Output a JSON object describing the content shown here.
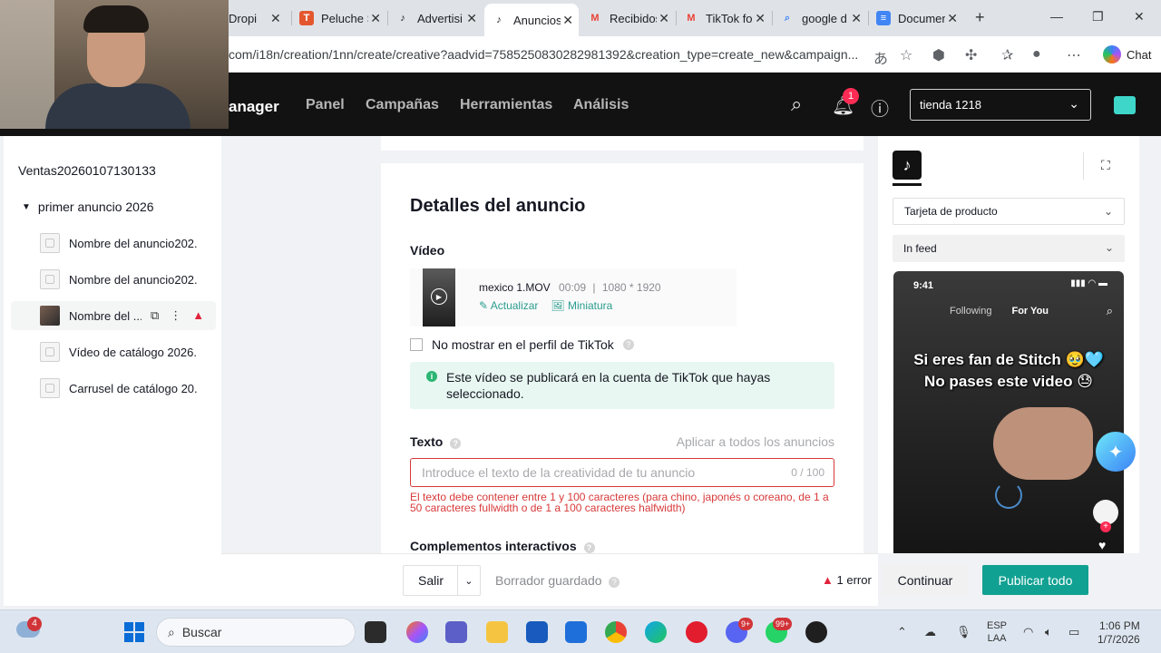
{
  "browser": {
    "tabs": [
      {
        "label": "Dropi",
        "favicon": "dropi",
        "color": "#e0e0e0"
      },
      {
        "label": "Peluche S",
        "favicon": "temu-T",
        "color": "#e4572e"
      },
      {
        "label": "Advertisi",
        "favicon": "tiktok",
        "color": "#121212"
      },
      {
        "label": "Anuncios",
        "favicon": "tiktok",
        "color": "#121212"
      },
      {
        "label": "Recibidos",
        "favicon": "gmail-M",
        "color": "#ea4335"
      },
      {
        "label": "TikTok fo",
        "favicon": "gmail-M",
        "color": "#ea4335"
      },
      {
        "label": "google d",
        "favicon": "search",
        "color": "#4285f4"
      },
      {
        "label": "Documen",
        "favicon": "docs",
        "color": "#4285f4"
      }
    ],
    "active_tab": 3,
    "url": "com/i18n/creation/1nn/create/creative?aadvid=7585250830282981392&creation_type=create_new&campaign...",
    "chat_label": "Chat"
  },
  "header": {
    "brand": "anager",
    "nav": [
      "Panel",
      "Campañas",
      "Herramientas",
      "Análisis"
    ],
    "notification_count": "1",
    "account": "tienda 1218"
  },
  "sidebar": {
    "campaign": "Ventas20260107130133",
    "group": "primer anuncio 2026",
    "items": [
      {
        "label": "Nombre del anuncio202...",
        "selected": false
      },
      {
        "label": "Nombre del anuncio202...",
        "selected": false
      },
      {
        "label": "Nombre del ...",
        "selected": true
      },
      {
        "label": "Vídeo de catálogo 2026...",
        "selected": false
      },
      {
        "label": "Carrusel de catálogo 20...",
        "selected": false
      }
    ]
  },
  "form": {
    "title": "Detalles del anuncio",
    "video_label": "Vídeo",
    "video": {
      "name": "mexico 1.MOV",
      "duration": "00:09",
      "separator": "|",
      "resolution": "1080 * 1920",
      "update_label": "Actualizar",
      "thumbnail_label": "Miniatura"
    },
    "hide_profile_label": "No mostrar en el perfil de TikTok",
    "info_text": "Este vídeo se publicará en la cuenta de TikTok que hayas seleccionado.",
    "text_label": "Texto",
    "apply_all_label": "Aplicar a todos los anuncios",
    "text_placeholder": "Introduce el texto de la creatividad de tu anuncio",
    "text_counter": "0 / 100",
    "text_error": "El texto debe contener entre 1 y 100 caracteres (para chino, japonés o coreano, de 1 a 50 caracteres fullwidth o de 1 a 100 caracteres halfwidth)",
    "interactive_label": "Complementos interactivos"
  },
  "bottom_bar": {
    "save_label": "Salir",
    "draft_label": "Borrador guardado",
    "error_label": "1 error",
    "continue_label": "Continuar",
    "publish_label": "Publicar todo"
  },
  "preview": {
    "format": "Tarjeta de producto",
    "placement": "In feed",
    "phone": {
      "time": "9:41",
      "tab_following": "Following",
      "tab_foryou": "For You",
      "caption_line1": "Si eres fan de Stitch 🥹🩵",
      "caption_line2": "No pases este video 😓"
    }
  },
  "taskbar": {
    "weather_badge": "4",
    "search_label": "Buscar",
    "messenger_badge": "9+",
    "whatsapp_badge": "99+",
    "lang_line1": "ESP",
    "lang_line2": "LAA",
    "time": "1:06 PM",
    "date": "1/7/2026"
  },
  "colors": {
    "accent": "#11a192",
    "error": "#d83939",
    "header_bg": "#121212",
    "notification": "#fe2c55"
  }
}
